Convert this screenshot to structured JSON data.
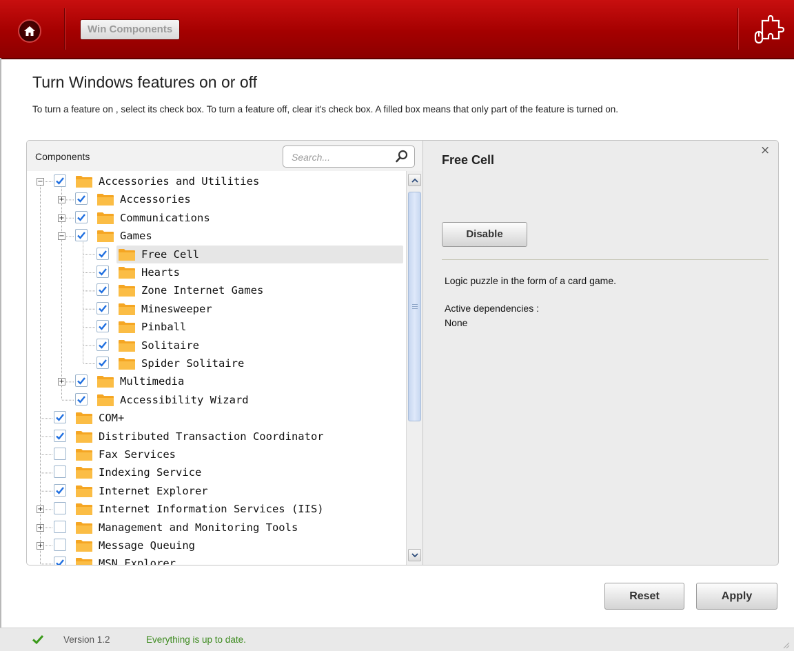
{
  "header": {
    "breadcrumb": "Win Components",
    "home_icon": "home-icon",
    "addon_icon": "puzzle-mouse-icon",
    "colors": {
      "bar": "#b40606",
      "bar_dark": "#8c0000"
    }
  },
  "page": {
    "title": "Turn Windows features on or off",
    "description": "To turn a feature on , select its check box. To turn a feature off, clear it's check box. A filled box means that only part of the feature is turned on."
  },
  "components": {
    "column_label": "Components",
    "search_placeholder": "Search...",
    "search_icon": "magnifier-icon",
    "tree": [
      {
        "label": "Accessories and Utilities",
        "level": 0,
        "checked": true,
        "expander": "minus"
      },
      {
        "label": "Accessories",
        "level": 1,
        "checked": true,
        "expander": "plus"
      },
      {
        "label": "Communications",
        "level": 1,
        "checked": true,
        "expander": "plus"
      },
      {
        "label": "Games",
        "level": 1,
        "checked": true,
        "expander": "minus"
      },
      {
        "label": "Free Cell",
        "level": 2,
        "checked": true,
        "expander": "none",
        "selected": true
      },
      {
        "label": "Hearts",
        "level": 2,
        "checked": true,
        "expander": "none"
      },
      {
        "label": "Zone Internet Games",
        "level": 2,
        "checked": true,
        "expander": "none"
      },
      {
        "label": "Minesweeper",
        "level": 2,
        "checked": true,
        "expander": "none"
      },
      {
        "label": "Pinball",
        "level": 2,
        "checked": true,
        "expander": "none"
      },
      {
        "label": "Solitaire",
        "level": 2,
        "checked": true,
        "expander": "none"
      },
      {
        "label": "Spider Solitaire",
        "level": 2,
        "checked": true,
        "expander": "none"
      },
      {
        "label": "Multimedia",
        "level": 1,
        "checked": true,
        "expander": "plus"
      },
      {
        "label": "Accessibility Wizard",
        "level": 1,
        "checked": true,
        "expander": "none"
      },
      {
        "label": "COM+",
        "level": 0,
        "checked": true,
        "expander": "none"
      },
      {
        "label": "Distributed Transaction Coordinator",
        "level": 0,
        "checked": true,
        "expander": "none"
      },
      {
        "label": "Fax Services",
        "level": 0,
        "checked": false,
        "expander": "none"
      },
      {
        "label": "Indexing Service",
        "level": 0,
        "checked": false,
        "expander": "none"
      },
      {
        "label": "Internet Explorer",
        "level": 0,
        "checked": true,
        "expander": "none"
      },
      {
        "label": "Internet Information Services (IIS)",
        "level": 0,
        "checked": false,
        "expander": "plus"
      },
      {
        "label": "Management and Monitoring Tools",
        "level": 0,
        "checked": false,
        "expander": "plus"
      },
      {
        "label": "Message Queuing",
        "level": 0,
        "checked": false,
        "expander": "plus"
      },
      {
        "label": "MSN Explorer",
        "level": 0,
        "checked": true,
        "expander": "none"
      }
    ]
  },
  "detail": {
    "title": "Free Cell",
    "disable_label": "Disable",
    "description": "Logic puzzle in the form of a card game.",
    "dependencies_label": "Active dependencies :",
    "dependencies_value": "None",
    "close_label": "×"
  },
  "actions": {
    "reset_label": "Reset",
    "apply_label": "Apply"
  },
  "status": {
    "version": "Version 1.2",
    "message": "Everything is up to date.",
    "check_icon": "check-icon",
    "message_color": "#3c8a1e"
  }
}
